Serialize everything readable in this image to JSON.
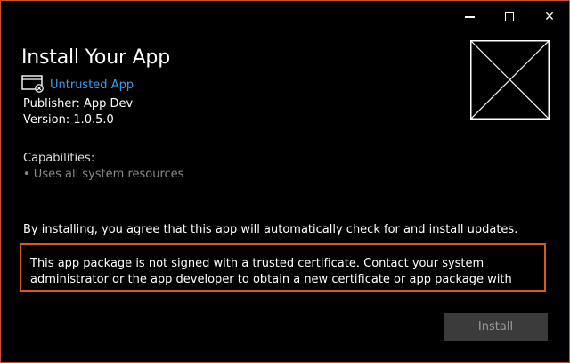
{
  "window": {
    "caption_minimize": "minimize-icon",
    "caption_maximize": "maximize-icon",
    "caption_close": "close-icon",
    "accent_border": "#c9532d"
  },
  "header": {
    "title": "Install Your App",
    "app_link": "Untrusted App",
    "publisher": "Publisher: App Dev",
    "version": "Version: 1.0.5.0"
  },
  "capabilities": {
    "title": "Capabilities:",
    "items": [
      "• Uses all system resources"
    ]
  },
  "body": {
    "agree_text": "By installing, you agree that this app will automatically check for and install updates.",
    "warning_text": "This app package is not signed with a trusted certificate. Contact your system administrator or the app developer to obtain a new certificate or app package with trusted certificates. The root certificate and all intermediate certificates of the signature in the app package must be verified",
    "warning_color": "#d9581f"
  },
  "footer": {
    "install_label": "Install"
  },
  "icons": {
    "app_small": "app-window-icon",
    "app_placeholder": "app-placeholder-icon"
  }
}
